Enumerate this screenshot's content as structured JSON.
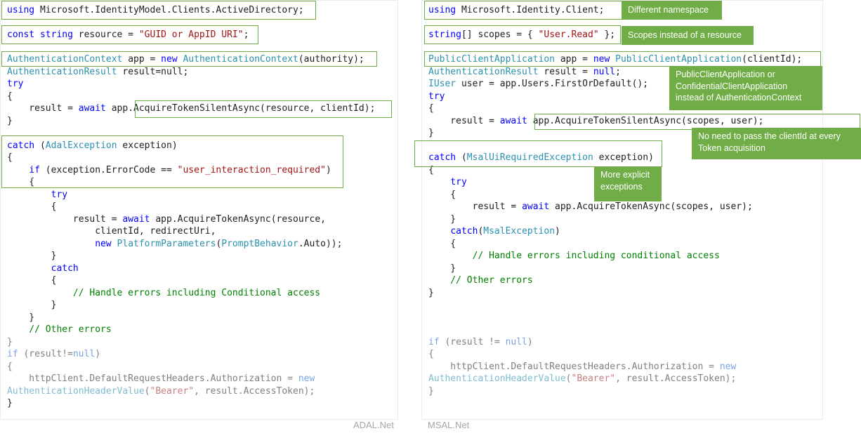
{
  "adal": {
    "label": "ADAL.Net",
    "using": {
      "kw": "using",
      "ns": " Microsoft.IdentityModel.Clients.ActiveDirectory;"
    },
    "resource": {
      "kw": "const string",
      "name": " resource = ",
      "value": "\"GUID or AppID URI\"",
      "end": ";"
    },
    "ctx_line": {
      "type": "AuthenticationContext",
      "mid": " app = ",
      "kw": "new",
      "type2": " AuthenticationContext",
      "args": "(authority);"
    },
    "result_line": {
      "type": "AuthenticationResult",
      "rest": " result=null;"
    },
    "try_kw": "try",
    "brace_open": "{",
    "brace_close": "}",
    "silent_line": {
      "pre": "    result = ",
      "kw": "await",
      "app": " app.",
      "call": "AcquireTokenSilentAsync(resource, clientId);"
    },
    "catch_line": {
      "kw": "catch",
      "open": " (",
      "type": "AdalException",
      "rest": " exception)"
    },
    "if_line": {
      "pre": "    ",
      "kw": "if",
      "rest": " (exception.ErrorCode == ",
      "str": "\"user_interaction_required\"",
      "end": ")"
    },
    "inner_open": "    {",
    "inner_try": "        try",
    "inner_try_open": "        {",
    "acq1": {
      "pre": "            result = ",
      "kw": "await",
      "rest": " app.AcquireTokenAsync(resource,"
    },
    "acq2": "                clientId, redirectUri,",
    "acq3": {
      "pre": "                ",
      "kw": "new",
      "type": " PlatformParameters",
      "open": "(",
      "type2": "PromptBehavior",
      "rest": ".Auto));"
    },
    "inner_try_close": "        }",
    "inner_catch": "        catch",
    "inner_catch_open": "        {",
    "inner_comment": "            // Handle errors including Conditional access",
    "inner_catch_close": "        }",
    "inner_close": "    }",
    "other_errors": "    // Other errors",
    "outer_close": "}",
    "if_result": {
      "kw": "if",
      "rest": " (result!=",
      "kw2": "null",
      "end": ")"
    },
    "http1": {
      "pre": "    httpClient.DefaultRequestHeaders.Authorization = ",
      "kw": "new"
    },
    "http2": {
      "type": "AuthenticationHeaderValue",
      "open": "(",
      "str": "\"Bearer\"",
      "rest": ", result.AccessToken);"
    }
  },
  "msal": {
    "label": "MSAL.Net",
    "using": {
      "kw": "using",
      "ns": " Microsoft.Identity.Client;"
    },
    "scopes": {
      "kw": "string",
      "name": "[] scopes = { ",
      "value": "\"User.Read\"",
      "end": " };"
    },
    "app_line": {
      "type": "PublicClientApplication",
      "mid": " app = ",
      "kw": "new",
      "type2": " PublicClientApplication",
      "args": "(clientId);"
    },
    "result_line": {
      "type": "AuthenticationResult",
      "rest": " result = ",
      "kw": "null",
      "end": ";"
    },
    "user_line": {
      "type": "IUser",
      "rest": " user = app.Users.FirstOrDefault();"
    },
    "try_kw": "try",
    "brace_open": "{",
    "brace_close": "}",
    "silent_line": {
      "pre": "    result = ",
      "kw": "await",
      "call": " app.AcquireTokenSilentAsync(scopes, user);"
    },
    "catch_line": {
      "kw": "catch",
      "open": " (",
      "type": "MsalUiRequiredException",
      "rest": " exception)"
    },
    "inner_try": "    try",
    "inner_try_open": "    {",
    "acq": {
      "pre": "        result = ",
      "kw": "await",
      "rest": " app.AcquireTokenAsync(scopes, user);"
    },
    "inner_try_close": "    }",
    "inner_catch": {
      "pre": "    ",
      "kw": "catch",
      "open": "(",
      "type": "MsalException",
      "end": ")"
    },
    "inner_catch_open": "    {",
    "inner_comment": "        // Handle errors including conditional access",
    "inner_catch_close": "    }",
    "other_errors": "    // Other errors",
    "outer_close": "}",
    "if_result": {
      "kw": "if",
      "rest": " (result != ",
      "kw2": "null",
      "end": ")"
    },
    "http1": {
      "pre": "    httpClient.DefaultRequestHeaders.Authorization = ",
      "kw": "new"
    },
    "http2": {
      "type": "AuthenticationHeaderValue",
      "open": "(",
      "str": "\"Bearer\"",
      "rest": ", result.AccessToken);"
    }
  },
  "callouts": {
    "namespace": "Different namespace",
    "scopes": "Scopes instead of a resource",
    "app": "PublicClientApplication or\nConfidentialClientApplication\ninstead of AuthenticationContext",
    "clientid": "No need to pass the clientId at every\nToken acquisition",
    "exceptions": "More explicit\nexceptions"
  },
  "colors": {
    "callout_bg": "#70ad47",
    "box_border": "#70ad47",
    "keyword": "#0000ff",
    "type": "#2b91af",
    "string": "#a31515",
    "comment": "#008000"
  }
}
